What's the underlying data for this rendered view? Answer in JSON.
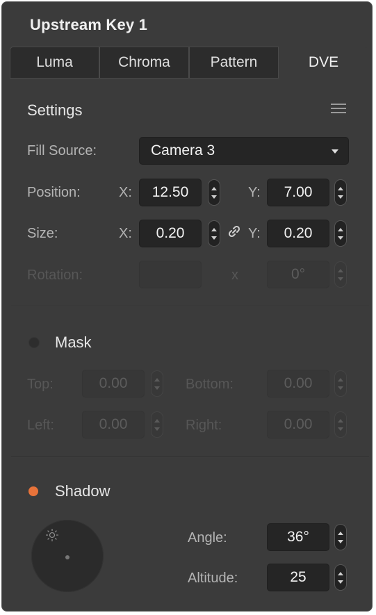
{
  "panel": {
    "title": "Upstream Key 1"
  },
  "tabs": [
    {
      "label": "Luma",
      "active": false
    },
    {
      "label": "Chroma",
      "active": false
    },
    {
      "label": "Pattern",
      "active": false
    },
    {
      "label": "DVE",
      "active": true
    }
  ],
  "settings": {
    "heading": "Settings",
    "menu_icon": "hamburger-menu-icon",
    "fill_source": {
      "label": "Fill Source:",
      "value": "Camera 3"
    },
    "position": {
      "label": "Position:",
      "x_label": "X:",
      "x_value": "12.50",
      "y_label": "Y:",
      "y_value": "7.00"
    },
    "size": {
      "label": "Size:",
      "x_label": "X:",
      "x_value": "0.20",
      "y_label": "Y:",
      "y_value": "0.20",
      "link_icon": "chain-link-icon"
    },
    "rotation": {
      "label": "Rotation:",
      "x_label": "x",
      "value": "0°"
    }
  },
  "mask": {
    "label": "Mask",
    "enabled": false,
    "top": {
      "label": "Top:",
      "value": "0.00"
    },
    "bottom": {
      "label": "Bottom:",
      "value": "0.00"
    },
    "left": {
      "label": "Left:",
      "value": "0.00"
    },
    "right": {
      "label": "Right:",
      "value": "0.00"
    }
  },
  "shadow": {
    "label": "Shadow",
    "enabled": true,
    "angle": {
      "label": "Angle:",
      "value": "36°"
    },
    "altitude": {
      "label": "Altitude:",
      "value": "25"
    },
    "light_icon": "sun-icon"
  },
  "colors": {
    "accent": "#e8733a",
    "panel_bg": "#3b3b3b",
    "field_bg": "#252525"
  }
}
